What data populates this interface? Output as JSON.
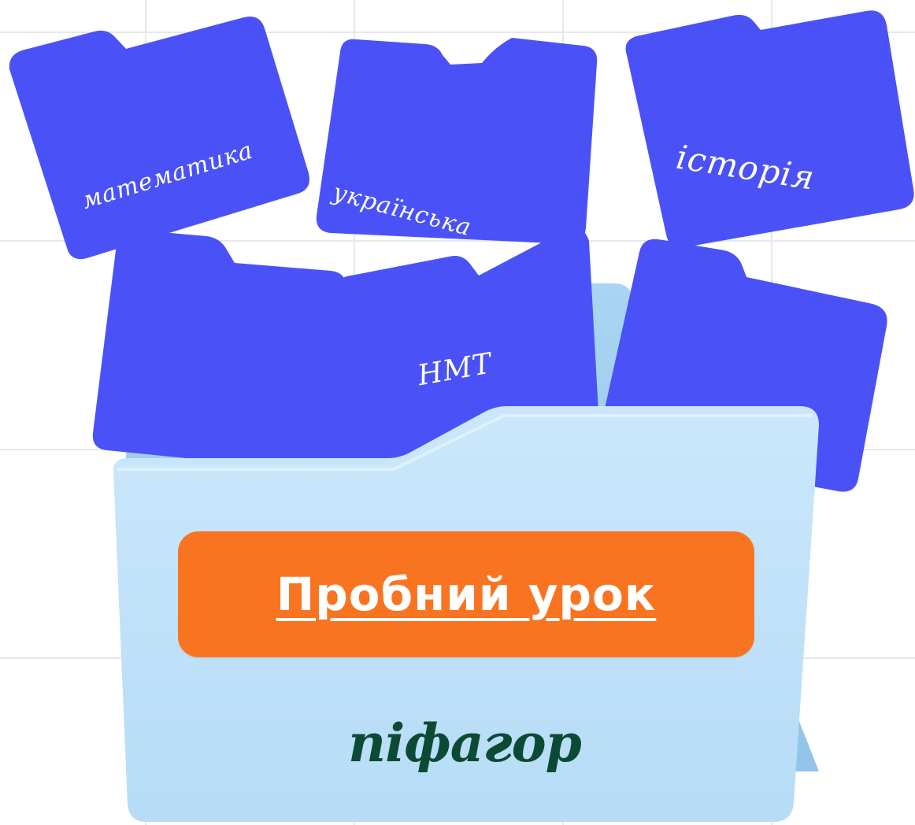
{
  "folders": {
    "math": {
      "label": "математика"
    },
    "ukrainian": {
      "label": "українська"
    },
    "history": {
      "label": "історія"
    },
    "nmt": {
      "label": "НМТ"
    }
  },
  "cta": {
    "label": "Пробний урок"
  },
  "logo": {
    "text": "піфагор"
  },
  "colors": {
    "folder_blue": "#4a52f7",
    "main_folder": "#c3e3fa",
    "cta_orange": "#f97421",
    "logo_green": "#0c4a34",
    "grid": "#e3e9ec"
  }
}
